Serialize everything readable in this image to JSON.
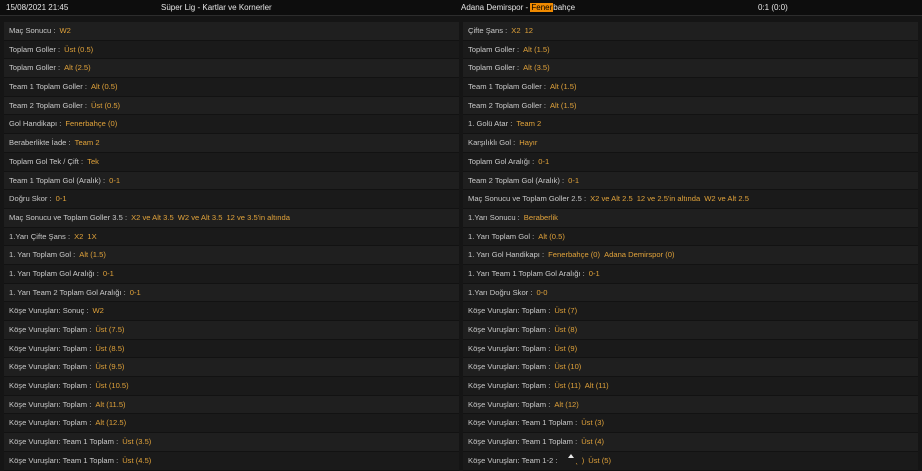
{
  "header": {
    "datetime": "15/08/2021 21:45",
    "league": "Süper Lig - Kartlar ve Kornerler",
    "match_prefix": "Adana Demirspor - ",
    "match_highlight": "Fener",
    "match_suffix": "bahçe",
    "score": "0:1 (0:0)"
  },
  "left": [
    {
      "label": "Maç Sonucu",
      "values": [
        "W2"
      ]
    },
    {
      "label": "Toplam Goller",
      "values": [
        "Üst (0.5)"
      ]
    },
    {
      "label": "Toplam Goller",
      "values": [
        "Alt (2.5)"
      ]
    },
    {
      "label": "Team 1 Toplam Goller",
      "values": [
        "Alt (0.5)"
      ]
    },
    {
      "label": "Team 2 Toplam Goller",
      "values": [
        "Üst (0.5)"
      ]
    },
    {
      "label": "Gol Handikapı",
      "values": [
        "Fenerbahçe (0)"
      ]
    },
    {
      "label": "Beraberlikte İade",
      "values": [
        "Team 2"
      ]
    },
    {
      "label": "Toplam Gol Tek / Çift",
      "values": [
        "Tek"
      ]
    },
    {
      "label": "Team 1 Toplam Gol (Aralık)",
      "values": [
        "0-1"
      ]
    },
    {
      "label": "Doğru Skor",
      "values": [
        "0-1"
      ]
    },
    {
      "label": "Maç Sonucu ve Toplam Goller 3.5",
      "values": [
        "X2 ve Alt 3.5",
        "W2 ve Alt 3.5",
        "12 ve 3.5'in altında"
      ]
    },
    {
      "label": "1.Yarı Çifte Şans",
      "values": [
        "X2",
        "1X"
      ]
    },
    {
      "label": "1. Yarı Toplam Gol",
      "values": [
        "Alt (1.5)"
      ]
    },
    {
      "label": "1. Yarı Toplam Gol Aralığı",
      "values": [
        "0-1"
      ]
    },
    {
      "label": "1. Yarı Team 2 Toplam Gol Aralığı",
      "values": [
        "0-1"
      ]
    },
    {
      "label": "Köşe Vuruşları: Sonuç",
      "values": [
        "W2"
      ]
    },
    {
      "label": "Köşe Vuruşları: Toplam",
      "values": [
        "Üst (7.5)"
      ]
    },
    {
      "label": "Köşe Vuruşları: Toplam",
      "values": [
        "Üst (8.5)"
      ]
    },
    {
      "label": "Köşe Vuruşları: Toplam",
      "values": [
        "Üst (9.5)"
      ]
    },
    {
      "label": "Köşe Vuruşları: Toplam",
      "values": [
        "Üst (10.5)"
      ]
    },
    {
      "label": "Köşe Vuruşları: Toplam",
      "values": [
        "Alt (11.5)"
      ]
    },
    {
      "label": "Köşe Vuruşları: Toplam",
      "values": [
        "Alt (12.5)"
      ]
    },
    {
      "label": "Köşe Vuruşları: Team 1 Toplam",
      "values": [
        "Üst (3.5)"
      ]
    },
    {
      "label": "Köşe Vuruşları: Team 1 Toplam",
      "values": [
        "Üst (4.5)"
      ]
    }
  ],
  "right": [
    {
      "label": "Çifte Şans",
      "values": [
        "X2",
        "12"
      ]
    },
    {
      "label": "Toplam Goller",
      "values": [
        "Alt (1.5)"
      ]
    },
    {
      "label": "Toplam Goller",
      "values": [
        "Alt (3.5)"
      ]
    },
    {
      "label": "Team 1 Toplam Goller",
      "values": [
        "Alt (1.5)"
      ]
    },
    {
      "label": "Team 2 Toplam Goller",
      "values": [
        "Alt (1.5)"
      ]
    },
    {
      "label": "1. Golü Atar",
      "values": [
        "Team 2"
      ]
    },
    {
      "label": "Karşılıklı Gol",
      "values": [
        "Hayır"
      ]
    },
    {
      "label": "Toplam Gol Aralığı",
      "values": [
        "0-1"
      ]
    },
    {
      "label": "Team 2 Toplam Gol (Aralık)",
      "values": [
        "0-1"
      ]
    },
    {
      "label": "Maç Sonucu ve Toplam Goller 2.5",
      "values": [
        "X2 ve Alt 2.5",
        "12 ve 2.5'in altında",
        "W2 ve Alt 2.5"
      ]
    },
    {
      "label": "1.Yarı Sonucu",
      "values": [
        "Beraberlik"
      ]
    },
    {
      "label": "1. Yarı Toplam Gol",
      "values": [
        "Alt (0.5)"
      ]
    },
    {
      "label": "1. Yarı Gol Handikapı",
      "values": [
        "Fenerbahçe (0)",
        "Adana Demirspor (0)"
      ]
    },
    {
      "label": "1. Yarı Team 1 Toplam Gol Aralığı",
      "values": [
        "0-1"
      ]
    },
    {
      "label": "1.Yarı Doğru Skor",
      "values": [
        "0-0"
      ]
    },
    {
      "label": "Köşe Vuruşları: Toplam",
      "values": [
        "Üst (7)"
      ]
    },
    {
      "label": "Köşe Vuruşları: Toplam",
      "values": [
        "Üst (8)"
      ]
    },
    {
      "label": "Köşe Vuruşları: Toplam",
      "values": [
        "Üst (9)"
      ]
    },
    {
      "label": "Köşe Vuruşları: Toplam",
      "values": [
        "Üst (10)"
      ]
    },
    {
      "label": "Köşe Vuruşları: Toplam",
      "values": [
        "Üst (11)",
        "Alt (11)"
      ]
    },
    {
      "label": "Köşe Vuruşları: Toplam",
      "values": [
        "Alt (12)"
      ]
    },
    {
      "label": "Köşe Vuruşları: Team 1 Toplam",
      "values": [
        "Üst (3)"
      ]
    },
    {
      "label": "Köşe Vuruşları: Team 1 Toplam",
      "values": [
        "Üst (4)"
      ]
    },
    {
      "label": "Köşe Vuruşları: Team 1-2",
      "values": [
        "Üst (5)",
        "Üst (5)"
      ]
    }
  ]
}
